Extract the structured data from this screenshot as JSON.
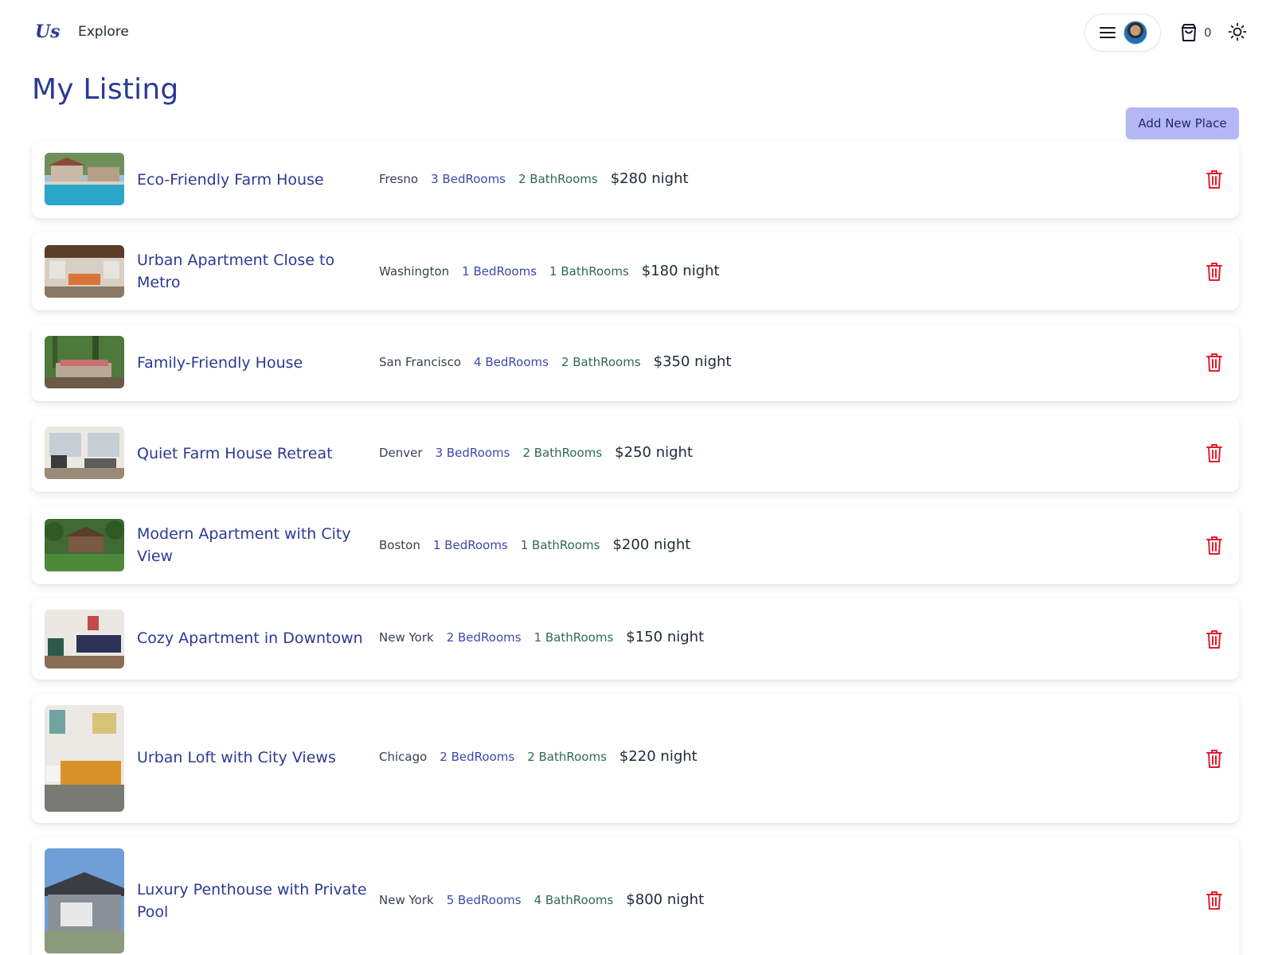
{
  "header": {
    "logo_text": "Us",
    "nav": {
      "explore_label": "Explore"
    },
    "cart_count": "0"
  },
  "page": {
    "title": "My Listing",
    "add_button_label": "Add New Place"
  },
  "listings": [
    {
      "title": "Eco-Friendly Farm House",
      "city": "Fresno",
      "bedrooms": "3 BedRooms",
      "bathrooms": "2 BathRooms",
      "price": "$280 night"
    },
    {
      "title": "Urban Apartment Close to Metro",
      "city": "Washington",
      "bedrooms": "1 BedRooms",
      "bathrooms": "1 BathRooms",
      "price": "$180 night"
    },
    {
      "title": "Family-Friendly House",
      "city": "San Francisco",
      "bedrooms": "4 BedRooms",
      "bathrooms": "2 BathRooms",
      "price": "$350 night"
    },
    {
      "title": "Quiet Farm House Retreat",
      "city": "Denver",
      "bedrooms": "3 BedRooms",
      "bathrooms": "2 BathRooms",
      "price": "$250 night"
    },
    {
      "title": "Modern Apartment with City View",
      "city": "Boston",
      "bedrooms": "1 BedRooms",
      "bathrooms": "1 BathRooms",
      "price": "$200 night"
    },
    {
      "title": "Cozy Apartment in Downtown",
      "city": "New York",
      "bedrooms": "2 BedRooms",
      "bathrooms": "1 BathRooms",
      "price": "$150 night"
    },
    {
      "title": "Urban Loft with City Views",
      "city": "Chicago",
      "bedrooms": "2 BedRooms",
      "bathrooms": "2 BathRooms",
      "price": "$220 night"
    },
    {
      "title": "Luxury Penthouse with Private Pool",
      "city": "New York",
      "bedrooms": "5 BedRooms",
      "bathrooms": "4 BathRooms",
      "price": "$800 night"
    }
  ],
  "colors": {
    "brand": "#2b3a93",
    "button_bg": "#b3b7f5",
    "delete": "#e11d2e",
    "bedrooms": "#3b4aa8",
    "bathrooms": "#2f6b4a"
  },
  "icons": [
    "hamburger-icon",
    "avatar",
    "shopping-bag-icon",
    "sun-icon",
    "trash-icon"
  ]
}
